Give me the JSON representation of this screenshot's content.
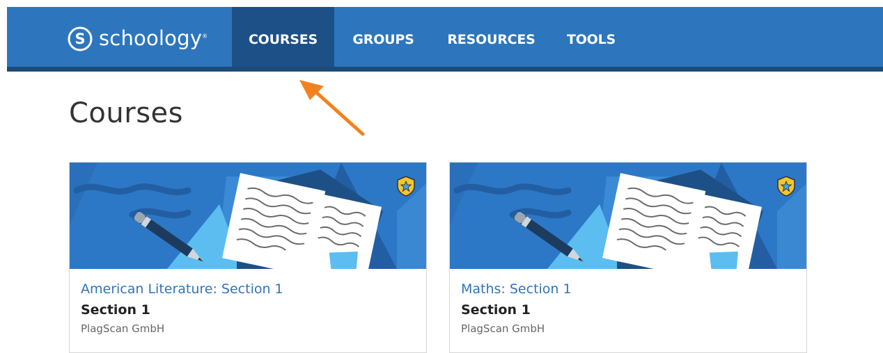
{
  "nav": {
    "logo_text": "schoology",
    "logo_tm": "®",
    "items": [
      {
        "label": "COURSES",
        "active": true
      },
      {
        "label": "GROUPS",
        "active": false
      },
      {
        "label": "RESOURCES",
        "active": false
      },
      {
        "label": "TOOLS",
        "active": false
      }
    ]
  },
  "page": {
    "title": "Courses"
  },
  "courses": [
    {
      "title": "American Literature: Section 1",
      "section": "Section 1",
      "organization": "PlagScan GmbH"
    },
    {
      "title": "Maths: Section 1",
      "section": "Section 1",
      "organization": "PlagScan GmbH"
    }
  ],
  "colors": {
    "nav_bg": "#2d76bd",
    "nav_active": "#1d5087",
    "link": "#2f74b8",
    "annotation_arrow": "#f28220",
    "badge": "#f2c531"
  }
}
